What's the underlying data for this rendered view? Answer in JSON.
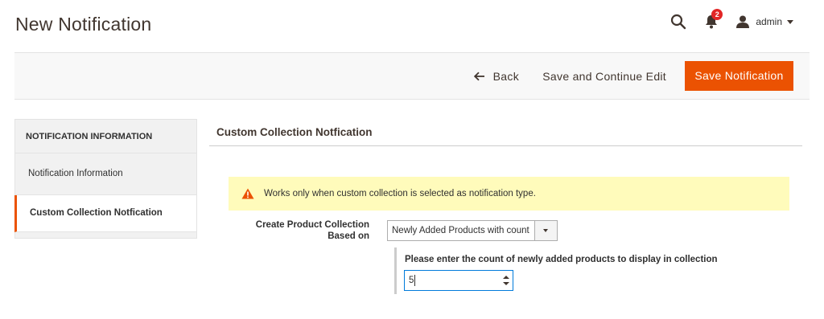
{
  "header": {
    "title": "New Notification",
    "notification_count": "2",
    "user_name": "admin",
    "icons": {
      "search": "search-icon",
      "notifications": "bell-icon",
      "user": "user-icon",
      "user_menu": "chevron-down-icon"
    }
  },
  "actions": {
    "back_label": "Back",
    "save_continue_label": "Save and Continue Edit",
    "save_label": "Save Notification",
    "save_color": "#eb5202"
  },
  "sidebar": {
    "title": "NOTIFICATION INFORMATION",
    "items": [
      {
        "label": "Notification Information",
        "active": false
      },
      {
        "label": "Custom Collection Notfication",
        "active": true
      }
    ]
  },
  "main": {
    "section_title": "Custom Collection Notfication",
    "notice": {
      "text": "Works only when custom collection is selected as notification type.",
      "icon": "warning-icon",
      "background": "#fffbbb"
    },
    "collection_field": {
      "label_line1": "Create Product Collection",
      "label_line2": "Based on",
      "selected_value": "Newly Added Products with count"
    },
    "count_field": {
      "label": "Please enter the count of newly added products to display in collection",
      "value": "5"
    }
  }
}
